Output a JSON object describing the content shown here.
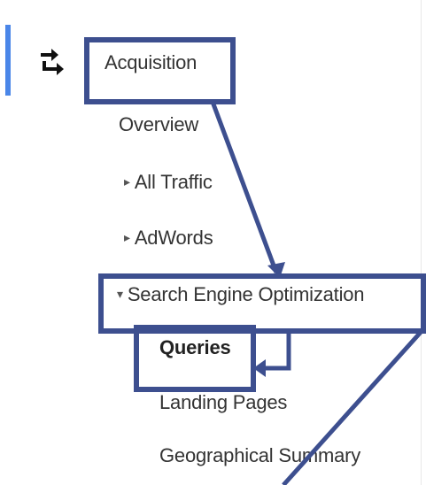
{
  "nav": {
    "acquisition": {
      "label": "Acquisition",
      "icon": "acquisition-arrows-icon"
    },
    "overview": "Overview",
    "all_traffic": {
      "label": "All Traffic",
      "expander": "▸",
      "state": "collapsed"
    },
    "adwords": {
      "label": "AdWords",
      "expander": "▸",
      "state": "collapsed"
    },
    "seo": {
      "label": "Search Engine Optimization",
      "expander": "▾",
      "state": "expanded"
    },
    "queries": {
      "label": "Queries",
      "selected": true
    },
    "landing_pages": "Landing Pages",
    "geo_summary": "Geographical Summary"
  },
  "colors": {
    "annotation": "#3d4f8f",
    "accent": "#4a86e8",
    "text": "#333333"
  }
}
